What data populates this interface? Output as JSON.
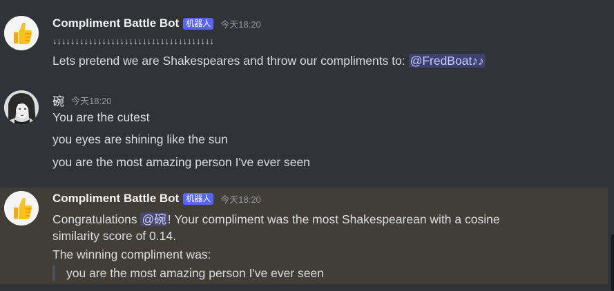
{
  "messages": [
    {
      "username": "Compliment Battle Bot",
      "bot_tag": "机器人",
      "time": "今天18:20",
      "arrows": "↓↓↓↓↓↓↓↓↓↓↓↓↓↓↓↓↓↓↓↓↓↓↓↓↓↓↓↓↓↓↓↓↓↓↓↓",
      "text": "Lets pretend we are Shakespeares and throw our compliments to: ",
      "mention": "@FredBoat♪♪"
    },
    {
      "username": "碗",
      "time": "今天18:20",
      "lines": [
        "You are the cutest",
        "you eyes are shining like the sun",
        "you are the most amazing person I've ever seen"
      ]
    },
    {
      "username": "Compliment Battle Bot",
      "bot_tag": "机器人",
      "time": "今天18:20",
      "text_prefix": "Congratulations ",
      "mention": "@碗",
      "text_suffix": "! Your compliment was the most Shakespearean with a cosine",
      "text_line2": "similarity score of 0.14.",
      "text_line3": "The winning compliment was:",
      "quote": "you are the most amazing person I've ever seen"
    }
  ]
}
